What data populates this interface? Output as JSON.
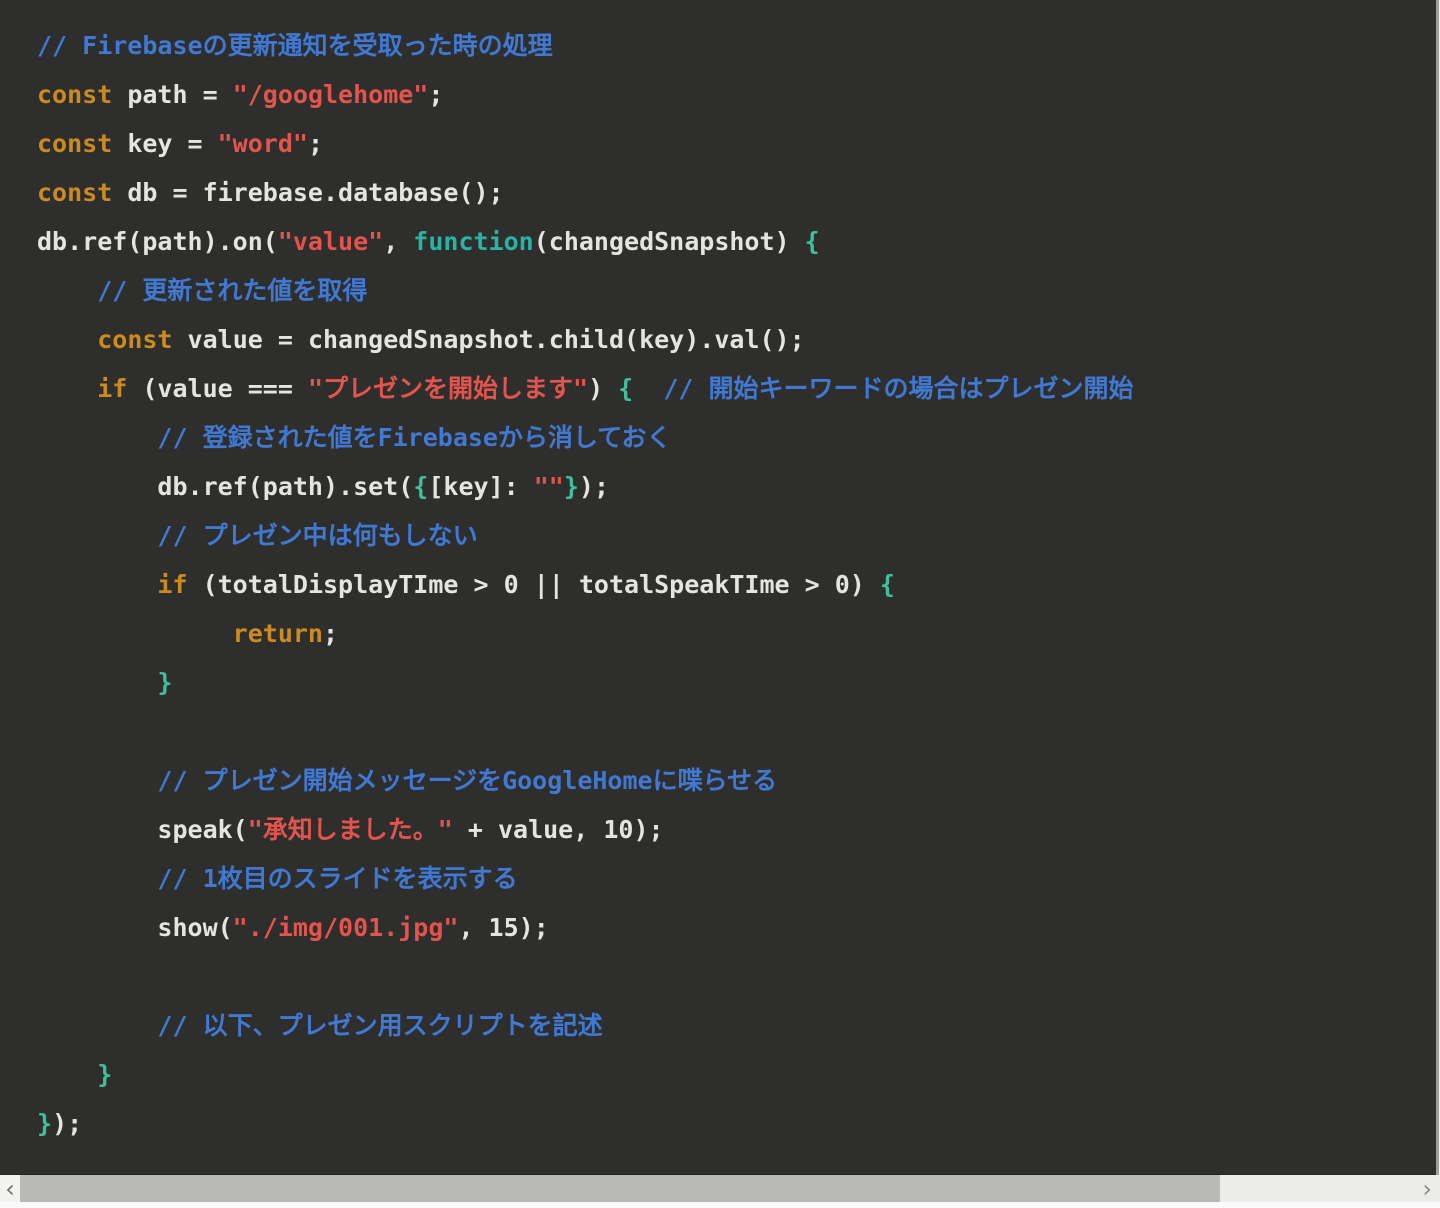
{
  "editor": {
    "background": "#2e2e2c",
    "colors": {
      "keyword": "#cc8b22",
      "string": "#e2544d",
      "comment": "#4078d2",
      "function_keyword": "#2ab3a5",
      "brace": "#3fc09c",
      "text": "#e4e4e2"
    },
    "language": "javascript",
    "lines": [
      [
        [
          "c",
          "// Firebaseの更新通知を受取った時の処理"
        ]
      ],
      [
        [
          "k",
          "const"
        ],
        [
          "t",
          " path = "
        ],
        [
          "s",
          "\"/googlehome\""
        ],
        [
          "t",
          ";"
        ]
      ],
      [
        [
          "k",
          "const"
        ],
        [
          "t",
          " key = "
        ],
        [
          "s",
          "\"word\""
        ],
        [
          "t",
          ";"
        ]
      ],
      [
        [
          "k",
          "const"
        ],
        [
          "t",
          " db = firebase.database();"
        ]
      ],
      [
        [
          "t",
          "db.ref(path).on("
        ],
        [
          "s",
          "\"value\""
        ],
        [
          "t",
          ", "
        ],
        [
          "f",
          "function"
        ],
        [
          "t",
          "(changedSnapshot) "
        ],
        [
          "b",
          "{"
        ]
      ],
      [
        [
          "t",
          "    "
        ],
        [
          "c",
          "// 更新された値を取得"
        ]
      ],
      [
        [
          "t",
          "    "
        ],
        [
          "k",
          "const"
        ],
        [
          "t",
          " value = changedSnapshot.child(key).val();"
        ]
      ],
      [
        [
          "t",
          "    "
        ],
        [
          "k",
          "if"
        ],
        [
          "t",
          " (value === "
        ],
        [
          "s",
          "\"プレゼンを開始します\""
        ],
        [
          "t",
          ") "
        ],
        [
          "b",
          "{"
        ],
        [
          "t",
          "  "
        ],
        [
          "c",
          "// 開始キーワードの場合はプレゼン開始"
        ]
      ],
      [
        [
          "t",
          "        "
        ],
        [
          "c",
          "// 登録された値をFirebaseから消しておく"
        ]
      ],
      [
        [
          "t",
          "        db.ref(path).set("
        ],
        [
          "b",
          "{"
        ],
        [
          "t",
          "[key]: "
        ],
        [
          "s",
          "\"\""
        ],
        [
          "b",
          "}"
        ],
        [
          "t",
          ");"
        ]
      ],
      [
        [
          "t",
          "        "
        ],
        [
          "c",
          "// プレゼン中は何もしない"
        ]
      ],
      [
        [
          "t",
          "        "
        ],
        [
          "k",
          "if"
        ],
        [
          "t",
          " (totalDisplayTIme > 0 || totalSpeakTIme > 0) "
        ],
        [
          "b",
          "{"
        ]
      ],
      [
        [
          "t",
          "             "
        ],
        [
          "k",
          "return"
        ],
        [
          "t",
          ";"
        ]
      ],
      [
        [
          "t",
          "        "
        ],
        [
          "b",
          "}"
        ]
      ],
      [],
      [
        [
          "t",
          "        "
        ],
        [
          "c",
          "// プレゼン開始メッセージをGoogleHomeに喋らせる"
        ]
      ],
      [
        [
          "t",
          "        speak("
        ],
        [
          "s",
          "\"承知しました。\""
        ],
        [
          "t",
          " + value, 10);"
        ]
      ],
      [
        [
          "t",
          "        "
        ],
        [
          "c",
          "// 1枚目のスライドを表示する"
        ]
      ],
      [
        [
          "t",
          "        show("
        ],
        [
          "s",
          "\"./img/001.jpg\""
        ],
        [
          "t",
          ", 15);"
        ]
      ],
      [],
      [
        [
          "t",
          "        "
        ],
        [
          "c",
          "// 以下、プレゼン用スクリプトを記述"
        ]
      ],
      [
        [
          "t",
          "    "
        ],
        [
          "b",
          "}"
        ]
      ],
      [
        [
          "b",
          "}"
        ],
        [
          "t",
          ");"
        ]
      ]
    ]
  },
  "scrollbar": {
    "left_arrow": "‹",
    "right_arrow": "›",
    "thumb_color": "#b9b9b7",
    "track_color": "#ececea"
  }
}
